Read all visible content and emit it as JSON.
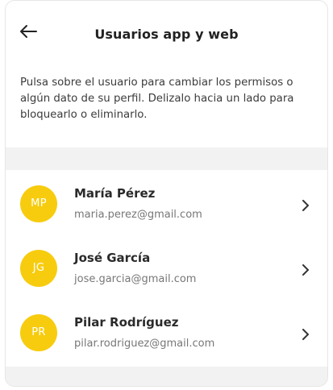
{
  "header": {
    "title": "Usuarios app y web",
    "back_icon": "arrow-left-icon"
  },
  "intro": {
    "text": "Pulsa sobre el usuario para cambiar los permisos o algún dato de su perfil. Delizalo hacia un lado para bloquearlo o eliminarlo."
  },
  "colors": {
    "avatar_bg": "#f7cc0e",
    "band_bg": "#f2f2f2"
  },
  "users": [
    {
      "initials": "MP",
      "name": "María Pérez",
      "email": "maria.perez@gmail.com",
      "action_icon": "chevron-right-icon"
    },
    {
      "initials": "JG",
      "name": "José García",
      "email": "jose.garcia@gmail.com",
      "action_icon": "chevron-right-icon"
    },
    {
      "initials": "PR",
      "name": "Pilar Rodríguez",
      "email": "pilar.rodriguez@gmail.com",
      "action_icon": "chevron-right-icon"
    }
  ]
}
